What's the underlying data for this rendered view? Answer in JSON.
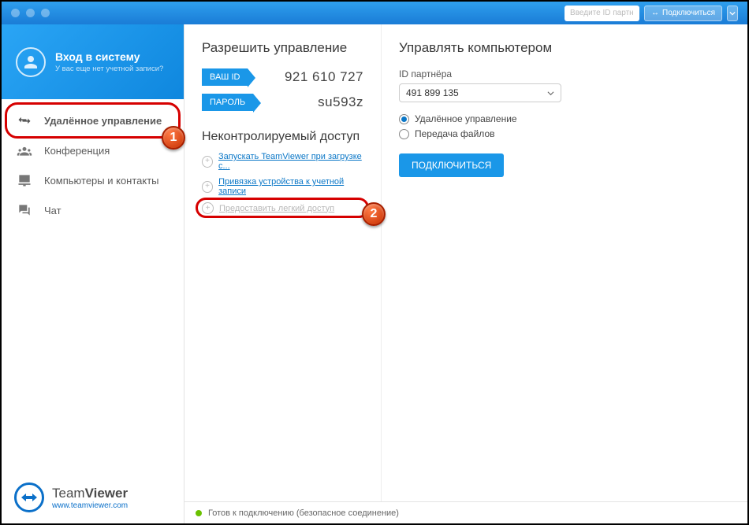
{
  "titlebar": {
    "partner_id_placeholder": "Введите ID партн",
    "connect_label": "Подключиться"
  },
  "sidebar": {
    "login_title": "Вход в систему",
    "login_subtitle": "У вас еще нет учетной записи?",
    "nav": [
      {
        "label": "Удалённое управление"
      },
      {
        "label": "Конференция"
      },
      {
        "label": "Компьютеры и контакты"
      },
      {
        "label": "Чат"
      }
    ],
    "brand_primary": "Team",
    "brand_secondary": "Viewer",
    "brand_url": "www.teamviewer.com"
  },
  "allow": {
    "title": "Разрешить управление",
    "id_label": "ВАШ ID",
    "id_value": "921 610 727",
    "password_label": "ПАРОЛЬ",
    "password_value": "su593z",
    "unattended_title": "Неконтролируемый доступ",
    "links": [
      "Запускать TeamViewer при загрузке с...",
      "Привязка устройства к учетной записи",
      "Предоставить легкий доступ"
    ]
  },
  "control": {
    "title": "Управлять компьютером",
    "partner_label": "ID партнёра",
    "partner_value": "491 899 135",
    "radio_remote": "Удалённое управление",
    "radio_files": "Передача файлов",
    "connect_btn": "ПОДКЛЮЧИТЬСЯ"
  },
  "status": {
    "text": "Готов к подключению (безопасное соединение)"
  },
  "annotations": {
    "badge1": "1",
    "badge2": "2"
  }
}
